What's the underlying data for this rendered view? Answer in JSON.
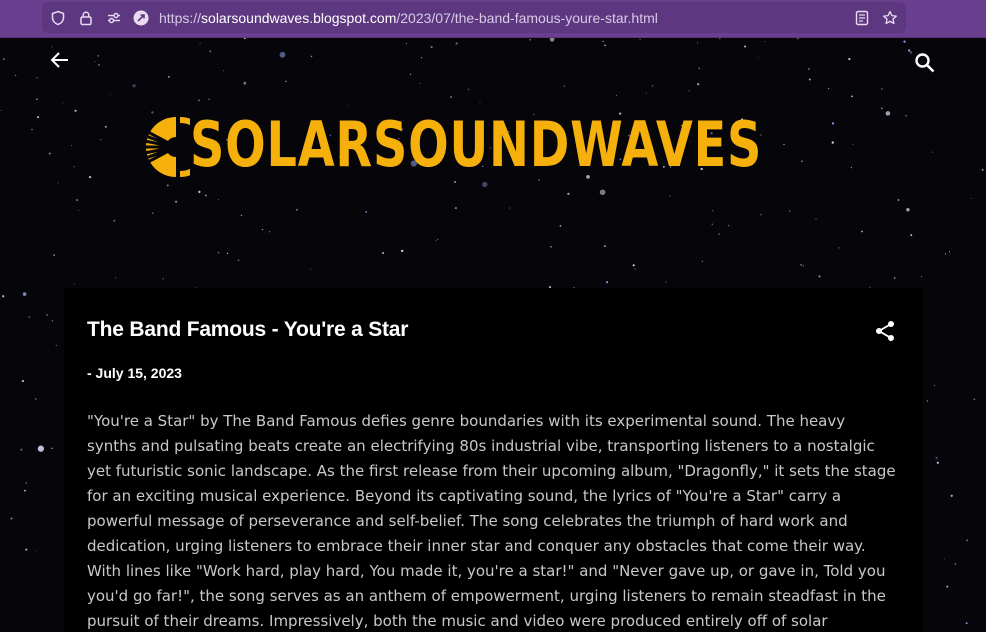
{
  "browser": {
    "url_prefix": "https://",
    "url_host": "solarsoundwaves.blogspot.com",
    "url_path": "/2023/07/the-band-famous-youre-star.html"
  },
  "header": {
    "logo_text": "SOLARSOUNDWAVES",
    "logo_color": "#f5b00b"
  },
  "post": {
    "title": "The Band Famous - You're a Star",
    "date": "- July 15, 2023",
    "body": "\"You're a Star\" by The Band Famous defies genre boundaries with its experimental sound. The heavy synths and pulsating beats create an electrifying 80s industrial vibe, transporting listeners to a nostalgic yet futuristic sonic landscape. As the first release from their upcoming album, \"Dragonfly,\" it sets the stage for an exciting musical experience. Beyond its captivating sound, the lyrics of \"You're a Star\" carry a powerful message of perseverance and self-belief. The song celebrates the triumph of hard work and dedication, urging listeners to embrace their inner star and conquer any obstacles that come their way. With lines like \"Work hard, play hard, You made it, you're a star!\" and \"Never gave up, or gave in, Told you you'd go far!\", the song serves as an anthem of empowerment, urging listeners to remain steadfast in the pursuit of their dreams. Impressively, both the music and video were produced entirely off of solar"
  },
  "icons": {
    "shield": "shield-icon",
    "lock": "lock-icon",
    "permissions": "permissions-icon",
    "site": "site-info-icon",
    "reader": "reader-view-icon",
    "bookmark": "bookmark-star-icon",
    "back": "back-arrow-icon",
    "search": "search-icon",
    "share": "share-icon",
    "sun": "sun-icon"
  }
}
